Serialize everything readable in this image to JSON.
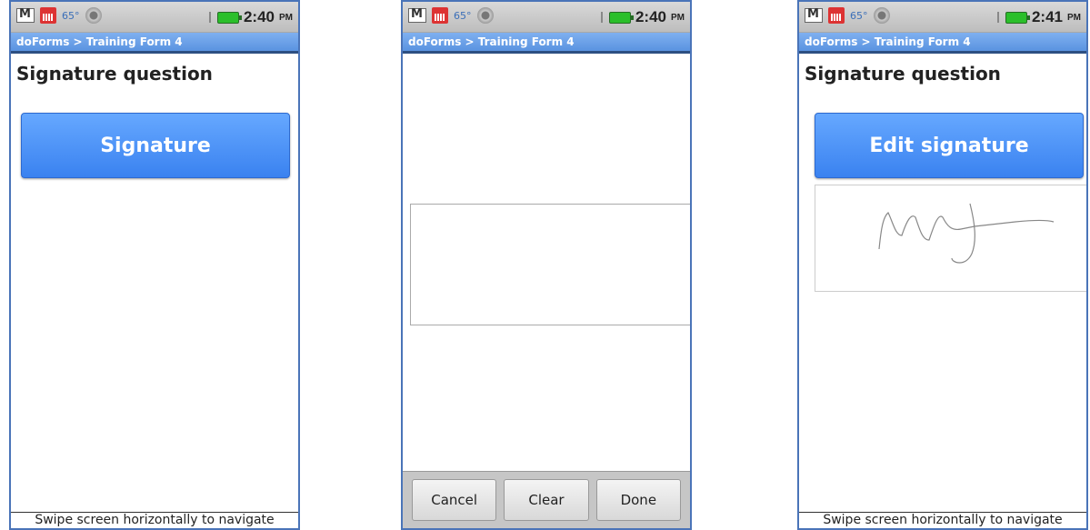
{
  "status_bar": {
    "temp": "65°",
    "ampm": "PM"
  },
  "screens": [
    {
      "breadcrumb": "doForms > Training Form 4",
      "question": "Signature question",
      "button": "Signature",
      "time": "2:40",
      "footer": "Swipe screen horizontally to navigate"
    },
    {
      "breadcrumb": "doForms > Training Form 4",
      "time": "2:40",
      "buttons": {
        "cancel": "Cancel",
        "clear": "Clear",
        "done": "Done"
      }
    },
    {
      "breadcrumb": "doForms > Training Form 4",
      "question": "Signature question",
      "button": "Edit signature",
      "time": "2:41",
      "footer": "Swipe screen horizontally to navigate"
    }
  ],
  "colors": {
    "accent": "#3a82f0",
    "title_bar": "#5a93e0",
    "frame": "#4a74b8"
  },
  "icons": [
    "gmail-icon",
    "calendar-icon",
    "camera-icon",
    "signal-icon",
    "battery-icon"
  ]
}
